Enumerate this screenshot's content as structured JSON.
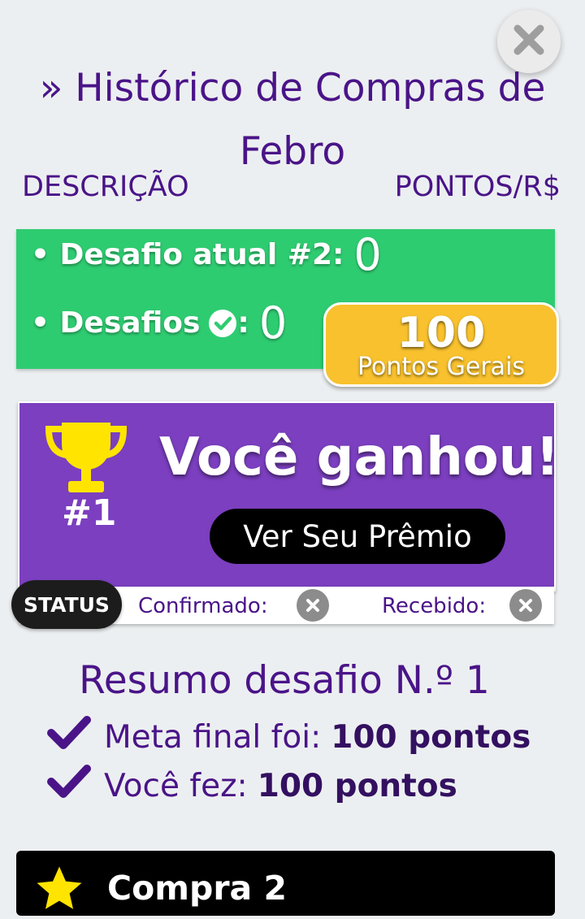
{
  "header": {
    "title": "» Histórico de Compras de Febro",
    "col_desc": "DESCRIÇÃO",
    "col_points": "PONTOS/R$"
  },
  "stats": {
    "desafio_atual_label": "• Desafio atual #2:",
    "desafio_atual_value": "0",
    "desafios_label": "• Desafios",
    "desafios_suffix": ":",
    "desafios_value": "0",
    "points_value": "100",
    "points_label": "Pontos Gerais"
  },
  "win": {
    "rank": "#1",
    "message": "Você ganhou!",
    "button": "Ver Seu Prêmio"
  },
  "status": {
    "label": "STATUS",
    "confirmado": "Confirmado:",
    "recebido": "Recebido:"
  },
  "summary": {
    "title": "Resumo desafio N.º 1",
    "meta_label": "Meta final foi:",
    "meta_value": "100 pontos",
    "fez_label": "Você fez:",
    "fez_value": "100 pontos"
  },
  "purchase": {
    "title": "Compra 2"
  },
  "colors": {
    "accent": "#4a1488",
    "green": "#2ecc71",
    "purple": "#7b3fbf",
    "gold": "#f8c12d",
    "trophy": "#ffe400"
  },
  "icons": [
    "close-icon",
    "check-circle-icon",
    "trophy-icon",
    "x-circle-icon",
    "checkmark-icon",
    "star-icon"
  ]
}
